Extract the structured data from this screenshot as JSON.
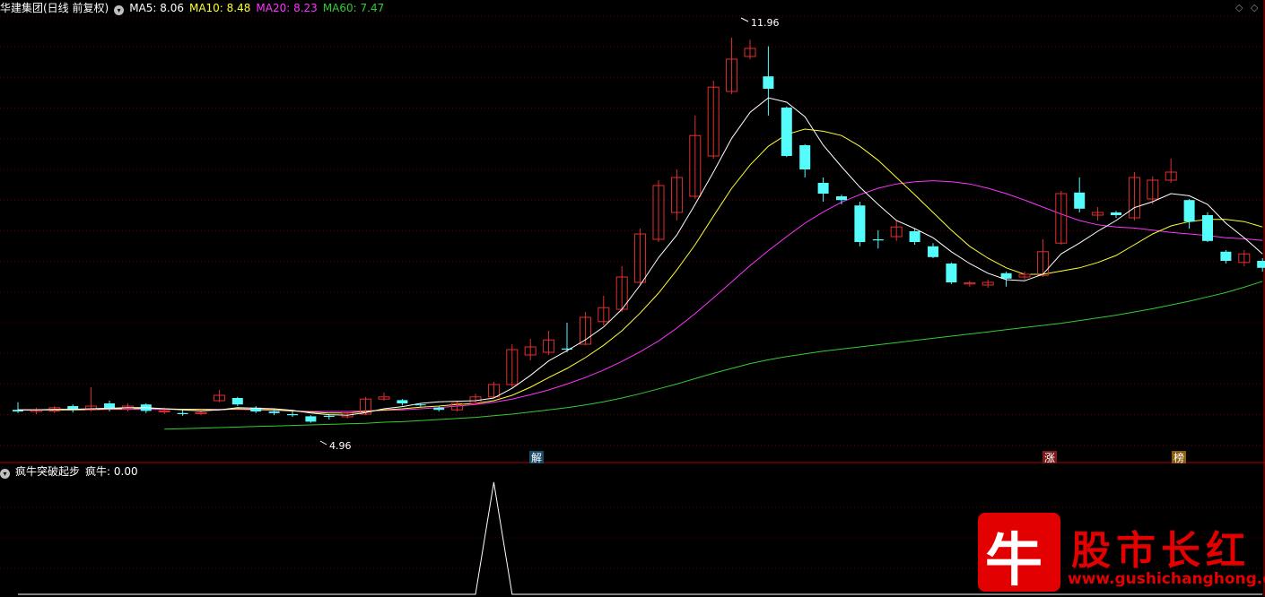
{
  "header": {
    "title": "华建集团(日线 前复权)",
    "ma5": "MA5: 8.06",
    "ma10": "MA10: 8.48",
    "ma20": "MA20: 8.23",
    "ma60": "MA60: 7.47"
  },
  "sub_header": {
    "name": "疯牛突破起步",
    "value": "疯牛: 0.00"
  },
  "markers": {
    "jie": "解",
    "zhang": "涨",
    "bang": "榜"
  },
  "annotations": {
    "high": "11.96",
    "low": "4.96"
  },
  "watermark": {
    "glyph": "牛",
    "title": "股市长红",
    "url": "www.gushichanghong.com"
  },
  "colors": {
    "up": "#e03030",
    "down": "#54fcfc",
    "ma5": "#ffffff",
    "ma10": "#ffff33",
    "ma20": "#ff33ff",
    "ma60": "#33cc33",
    "grid": "#5a0000",
    "frame": "#b00000"
  },
  "chart_data": {
    "type": "candlestick",
    "ylim": [
      4.5,
      12.4
    ],
    "candles": [
      [
        5.08,
        5.05,
        5.22,
        5.02
      ],
      [
        5.05,
        5.08,
        5.12,
        5.0
      ],
      [
        5.06,
        5.12,
        5.15,
        5.02
      ],
      [
        5.15,
        5.08,
        5.18,
        5.03
      ],
      [
        5.08,
        5.15,
        5.5,
        5.05
      ],
      [
        5.2,
        5.1,
        5.25,
        5.05
      ],
      [
        5.1,
        5.15,
        5.2,
        5.05
      ],
      [
        5.18,
        5.06,
        5.2,
        5.02
      ],
      [
        5.05,
        5.06,
        5.12,
        5.0
      ],
      [
        5.02,
        5.0,
        5.08,
        4.97
      ],
      [
        5.01,
        5.03,
        5.06,
        4.98
      ],
      [
        5.25,
        5.35,
        5.45,
        5.22
      ],
      [
        5.3,
        5.18,
        5.32,
        5.15
      ],
      [
        5.12,
        5.05,
        5.15,
        5.02
      ],
      [
        5.05,
        5.02,
        5.1,
        4.98
      ],
      [
        5.0,
        4.98,
        5.05,
        4.95
      ],
      [
        4.96,
        4.86,
        4.98,
        4.84
      ],
      [
        4.97,
        4.95,
        5.0,
        4.9
      ],
      [
        4.95,
        5.02,
        5.05,
        4.92
      ],
      [
        5.0,
        5.28,
        5.32,
        4.98
      ],
      [
        5.28,
        5.32,
        5.4,
        5.25
      ],
      [
        5.26,
        5.2,
        5.28,
        5.16
      ],
      [
        5.18,
        5.17,
        5.2,
        5.14
      ],
      [
        5.12,
        5.08,
        5.15,
        5.05
      ],
      [
        5.08,
        5.2,
        5.25,
        5.05
      ],
      [
        5.2,
        5.32,
        5.38,
        5.18
      ],
      [
        5.32,
        5.55,
        5.6,
        5.3
      ],
      [
        5.55,
        6.2,
        6.3,
        5.5
      ],
      [
        6.1,
        6.25,
        6.4,
        6.0
      ],
      [
        6.15,
        6.38,
        6.55,
        6.1
      ],
      [
        6.22,
        6.2,
        6.7,
        6.15
      ],
      [
        6.3,
        6.8,
        6.9,
        6.28
      ],
      [
        6.72,
        6.98,
        7.2,
        6.65
      ],
      [
        6.95,
        7.55,
        7.75,
        6.9
      ],
      [
        7.45,
        8.35,
        8.45,
        7.4
      ],
      [
        8.25,
        9.25,
        9.35,
        8.2
      ],
      [
        8.75,
        9.4,
        9.55,
        8.6
      ],
      [
        9.05,
        10.18,
        10.55,
        9.0
      ],
      [
        9.8,
        11.08,
        11.2,
        9.75
      ],
      [
        11.0,
        11.6,
        12.0,
        10.95
      ],
      [
        11.65,
        11.8,
        11.96,
        11.6
      ],
      [
        11.28,
        11.05,
        11.84,
        10.55
      ],
      [
        10.7,
        9.8,
        10.72,
        9.78
      ],
      [
        10.0,
        9.55,
        10.02,
        9.4
      ],
      [
        9.3,
        9.1,
        9.4,
        8.95
      ],
      [
        9.05,
        8.98,
        9.08,
        8.9
      ],
      [
        8.88,
        8.2,
        8.95,
        8.12
      ],
      [
        8.25,
        8.23,
        8.42,
        8.08
      ],
      [
        8.3,
        8.48,
        8.6,
        8.22
      ],
      [
        8.4,
        8.2,
        8.45,
        8.15
      ],
      [
        8.12,
        7.92,
        8.18,
        7.9
      ],
      [
        7.8,
        7.45,
        7.82,
        7.42
      ],
      [
        7.42,
        7.44,
        7.48,
        7.37
      ],
      [
        7.4,
        7.45,
        7.5,
        7.35
      ],
      [
        7.62,
        7.52,
        7.65,
        7.37
      ],
      [
        7.55,
        7.6,
        7.65,
        7.5
      ],
      [
        7.58,
        8.02,
        8.25,
        7.55
      ],
      [
        8.18,
        9.1,
        9.15,
        8.15
      ],
      [
        9.12,
        8.82,
        9.4,
        8.75
      ],
      [
        8.7,
        8.75,
        8.85,
        8.6
      ],
      [
        8.75,
        8.7,
        8.78,
        8.65
      ],
      [
        8.65,
        9.4,
        9.5,
        8.6
      ],
      [
        9.0,
        9.35,
        9.42,
        8.9
      ],
      [
        9.35,
        9.5,
        9.75,
        9.3
      ],
      [
        8.98,
        8.58,
        9.0,
        8.45
      ],
      [
        8.7,
        8.22,
        8.75,
        8.2
      ],
      [
        8.02,
        7.85,
        8.05,
        7.8
      ],
      [
        7.82,
        7.98,
        8.05,
        7.75
      ],
      [
        7.85,
        7.72,
        7.9,
        7.65
      ]
    ],
    "ma5": [
      5.08,
      5.08,
      5.09,
      5.09,
      5.1,
      5.11,
      5.12,
      5.12,
      5.1,
      5.08,
      5.06,
      5.08,
      5.12,
      5.11,
      5.1,
      5.07,
      5.02,
      4.99,
      4.98,
      5.03,
      5.1,
      5.14,
      5.2,
      5.23,
      5.24,
      5.25,
      5.3,
      5.48,
      5.72,
      5.99,
      6.18,
      6.38,
      6.62,
      6.95,
      7.4,
      7.91,
      8.33,
      8.9,
      9.5,
      10.13,
      10.61,
      10.88,
      10.8,
      10.53,
      10.0,
      9.6,
      9.22,
      8.9,
      8.6,
      8.45,
      8.28,
      8.02,
      7.8,
      7.62,
      7.5,
      7.48,
      7.6,
      7.98,
      8.18,
      8.4,
      8.6,
      8.84,
      8.95,
      9.1,
      9.06,
      8.9,
      8.55,
      8.28,
      7.98
    ],
    "ma10": [
      5.08,
      5.08,
      5.08,
      5.08,
      5.09,
      5.1,
      5.1,
      5.11,
      5.1,
      5.09,
      5.09,
      5.08,
      5.1,
      5.09,
      5.08,
      5.06,
      5.04,
      5.02,
      5.02,
      5.05,
      5.08,
      5.1,
      5.13,
      5.15,
      5.18,
      5.2,
      5.25,
      5.35,
      5.5,
      5.68,
      5.85,
      6.05,
      6.28,
      6.55,
      6.88,
      7.25,
      7.68,
      8.15,
      8.68,
      9.2,
      9.63,
      9.98,
      10.2,
      10.3,
      10.26,
      10.18,
      9.98,
      9.72,
      9.4,
      9.08,
      8.75,
      8.42,
      8.12,
      7.9,
      7.72,
      7.6,
      7.6,
      7.66,
      7.72,
      7.82,
      7.95,
      8.15,
      8.35,
      8.5,
      8.58,
      8.62,
      8.62,
      8.58,
      8.48
    ],
    "ma20": [
      5.08,
      5.08,
      5.08,
      5.08,
      5.08,
      5.09,
      5.09,
      5.09,
      5.09,
      5.09,
      5.09,
      5.09,
      5.09,
      5.08,
      5.07,
      5.06,
      5.05,
      5.05,
      5.05,
      5.06,
      5.07,
      5.08,
      5.1,
      5.12,
      5.15,
      5.18,
      5.22,
      5.28,
      5.36,
      5.45,
      5.56,
      5.68,
      5.82,
      5.98,
      6.16,
      6.36,
      6.6,
      6.87,
      7.16,
      7.46,
      7.76,
      8.04,
      8.3,
      8.55,
      8.76,
      8.94,
      9.08,
      9.2,
      9.28,
      9.32,
      9.34,
      9.32,
      9.28,
      9.2,
      9.1,
      8.98,
      8.85,
      8.72,
      8.6,
      8.52,
      8.48,
      8.46,
      8.42,
      8.38,
      8.35,
      8.32,
      8.28,
      8.26,
      8.23
    ],
    "ma60": [
      null,
      null,
      null,
      null,
      null,
      null,
      null,
      null,
      4.72,
      4.73,
      4.74,
      4.75,
      4.76,
      4.77,
      4.78,
      4.79,
      4.8,
      4.81,
      4.82,
      4.83,
      4.85,
      4.86,
      4.88,
      4.9,
      4.92,
      4.94,
      4.97,
      5.0,
      5.04,
      5.08,
      5.12,
      5.17,
      5.23,
      5.3,
      5.38,
      5.47,
      5.56,
      5.66,
      5.76,
      5.85,
      5.94,
      6.01,
      6.07,
      6.12,
      6.17,
      6.21,
      6.25,
      6.29,
      6.33,
      6.37,
      6.41,
      6.45,
      6.49,
      6.53,
      6.57,
      6.61,
      6.65,
      6.69,
      6.74,
      6.79,
      6.84,
      6.9,
      6.96,
      7.03,
      7.1,
      7.18,
      7.26,
      7.36,
      7.47
    ],
    "indicator": {
      "name": "疯牛",
      "ylim": [
        0,
        1
      ],
      "values": [
        0,
        0,
        0,
        0,
        0,
        0,
        0,
        0,
        0,
        0,
        0,
        0,
        0,
        0,
        0,
        0,
        0,
        0,
        0,
        0,
        0,
        0,
        0,
        0,
        0,
        0,
        1,
        0,
        0,
        0,
        0,
        0,
        0,
        0,
        0,
        0,
        0,
        0,
        0,
        0,
        0,
        0,
        0,
        0,
        0,
        0,
        0,
        0,
        0,
        0,
        0,
        0,
        0,
        0,
        0,
        0,
        0,
        0,
        0,
        0,
        0,
        0,
        0,
        0,
        0,
        0,
        0,
        0,
        0
      ]
    }
  }
}
